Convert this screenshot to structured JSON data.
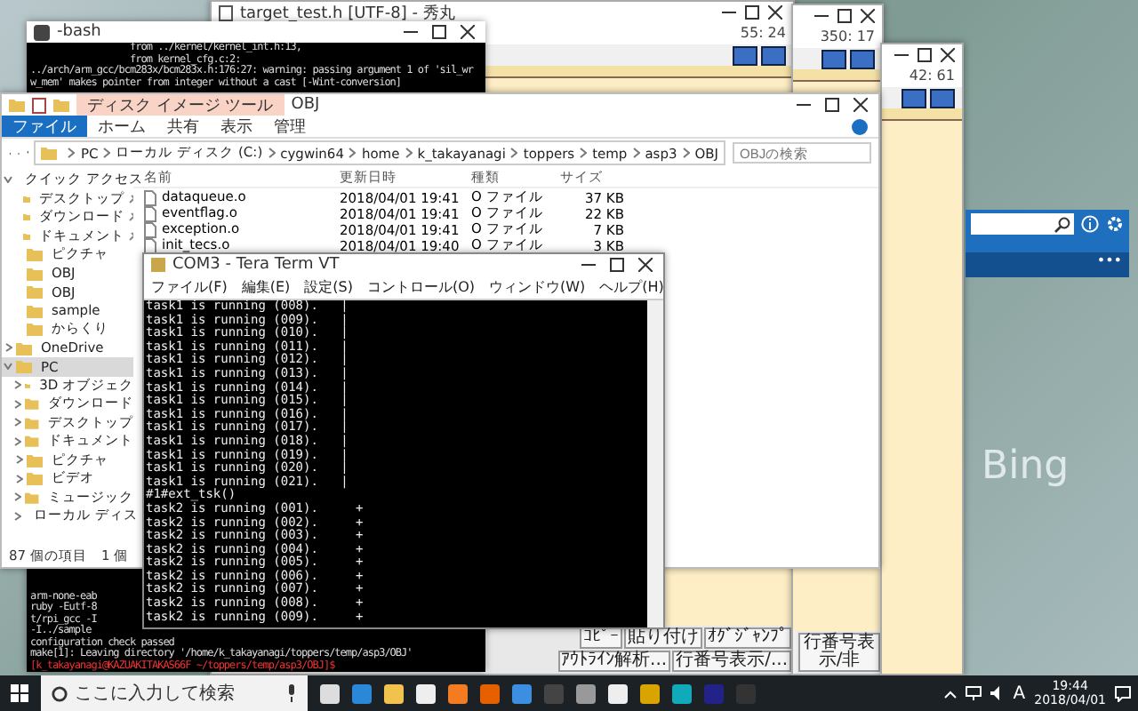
{
  "desktop": {
    "wallpaper_caption": "Bing"
  },
  "bing_panel": {
    "menu": "•••"
  },
  "editors": [
    {
      "title": "target_test.h [UTF-8] - 秀丸",
      "cursor": "55: 24",
      "function_keys": [
        "ｺﾋﾟｰ",
        "貼り付け",
        "ｵｸﾞｼﾞｬﾝﾌﾟ",
        "ｱｳﾄﾗｲﾝ解析...",
        "行番号表示/..."
      ]
    },
    {
      "cursor": "350: 17",
      "function_keys": [
        "行番号表示/非"
      ]
    },
    {
      "cursor": "42: 61"
    }
  ],
  "bash": {
    "title": "-bash",
    "top_lines": [
      "                  from ../kernel/kernel_int.h:13,",
      "                  from kernel_cfg.c:2:",
      "../arch/arm_gcc/bcm283x/bcm283x.h:176:27: warning: passing argument 1 of 'sil_wr",
      "w_mem' makes pointer from integer without a cast [-Wint-conversion]"
    ],
    "bottom_lines": [
      "arm-none-eab",
      "ruby -Eutf-8",
      "t/rpi_gcc -I",
      "-I../sample",
      "configuration check passed",
      "make[1]: Leaving directory '/home/k_takayanagi/toppers/temp/asp3/OBJ'"
    ],
    "prompt": "[k_takayanagi@KAZUAKITAKAS66F ~/toppers/temp/asp3/OBJ]$"
  },
  "explorer": {
    "title": "OBJ",
    "context_tab": "ディスク イメージ ツール",
    "ribbon_tabs": [
      {
        "label": "ファイル",
        "selected": true
      },
      {
        "label": "ホーム",
        "selected": false
      },
      {
        "label": "共有",
        "selected": false
      },
      {
        "label": "表示",
        "selected": false
      },
      {
        "label": "管理",
        "selected": false
      }
    ],
    "path": [
      "PC",
      "ローカル ディスク (C:)",
      "cygwin64",
      "home",
      "k_takayanagi",
      "toppers",
      "temp",
      "asp3",
      "OBJ"
    ],
    "search": {
      "placeholder": "OBJの検索"
    },
    "columns": [
      "名前",
      "更新日時",
      "種類",
      "サイズ"
    ],
    "files": [
      {
        "name": "dataqueue.o",
        "modified": "2018/04/01 19:41",
        "type": "O ファイル",
        "size": "37 KB"
      },
      {
        "name": "eventflag.o",
        "modified": "2018/04/01 19:41",
        "type": "O ファイル",
        "size": "22 KB"
      },
      {
        "name": "exception.o",
        "modified": "2018/04/01 19:41",
        "type": "O ファイル",
        "size": "7 KB"
      },
      {
        "name": "init_tecs.o",
        "modified": "2018/04/01 19:40",
        "type": "O ファイル",
        "size": "3 KB"
      }
    ],
    "nav": [
      {
        "label": "クイック アクセス",
        "expanded": true,
        "selected": false,
        "children": [
          {
            "label": "デスクトップ",
            "pinned": true,
            "selected": false
          },
          {
            "label": "ダウンロード",
            "pinned": true,
            "selected": false
          },
          {
            "label": "ドキュメント",
            "pinned": true,
            "selected": false
          },
          {
            "label": "ピクチャ",
            "pinned": false,
            "selected": false
          },
          {
            "label": "OBJ",
            "pinned": false,
            "selected": false
          },
          {
            "label": "OBJ",
            "pinned": false,
            "selected": false
          },
          {
            "label": "sample",
            "pinned": false,
            "selected": false
          },
          {
            "label": "からくり",
            "pinned": false,
            "selected": false
          }
        ]
      },
      {
        "label": "OneDrive",
        "expanded": false,
        "selected": false
      },
      {
        "label": "PC",
        "expanded": true,
        "selected": true,
        "children": [
          {
            "label": "3D オブジェク",
            "expanded": false,
            "selected": false
          },
          {
            "label": "ダウンロード",
            "expanded": false,
            "selected": false
          },
          {
            "label": "デスクトップ",
            "expanded": false,
            "selected": false
          },
          {
            "label": "ドキュメント",
            "expanded": false,
            "selected": false
          },
          {
            "label": "ピクチャ",
            "expanded": false,
            "selected": false
          },
          {
            "label": "ビデオ",
            "expanded": false,
            "selected": false
          },
          {
            "label": "ミュージック",
            "expanded": false,
            "selected": false
          },
          {
            "label": "ローカル ディス",
            "expanded": false,
            "selected": false
          }
        ]
      }
    ],
    "status": [
      "87 個の項目",
      "1 個"
    ]
  },
  "teraterm": {
    "title": "COM3 - Tera Term VT",
    "menu": [
      "ファイル(F)",
      "編集(E)",
      "設定(S)",
      "コントロール(O)",
      "ウィンドウ(W)",
      "ヘルプ(H)"
    ],
    "lines": [
      "task1 is running (008).   |",
      "task1 is running (009).   |",
      "task1 is running (010).   |",
      "task1 is running (011).   |",
      "task1 is running (012).   |",
      "task1 is running (013).   |",
      "task1 is running (014).   |",
      "task1 is running (015).   |",
      "task1 is running (016).   |",
      "task1 is running (017).   |",
      "task1 is running (018).   |",
      "task1 is running (019).   |",
      "task1 is running (020).   |",
      "task1 is running (021).   |",
      "#1#ext_tsk()",
      "task2 is running (001).     +",
      "task2 is running (002).     +",
      "task2 is running (003).     +",
      "task2 is running (004).     +",
      "task2 is running (005).     +",
      "task2 is running (006).     +",
      "task2 is running (007).     +",
      "task2 is running (008).     +",
      "task2 is running (009).     +"
    ]
  },
  "taskbar": {
    "search_placeholder": "ここに入力して検索",
    "ime": "A",
    "time": "19:44",
    "date": "2018/04/01"
  }
}
